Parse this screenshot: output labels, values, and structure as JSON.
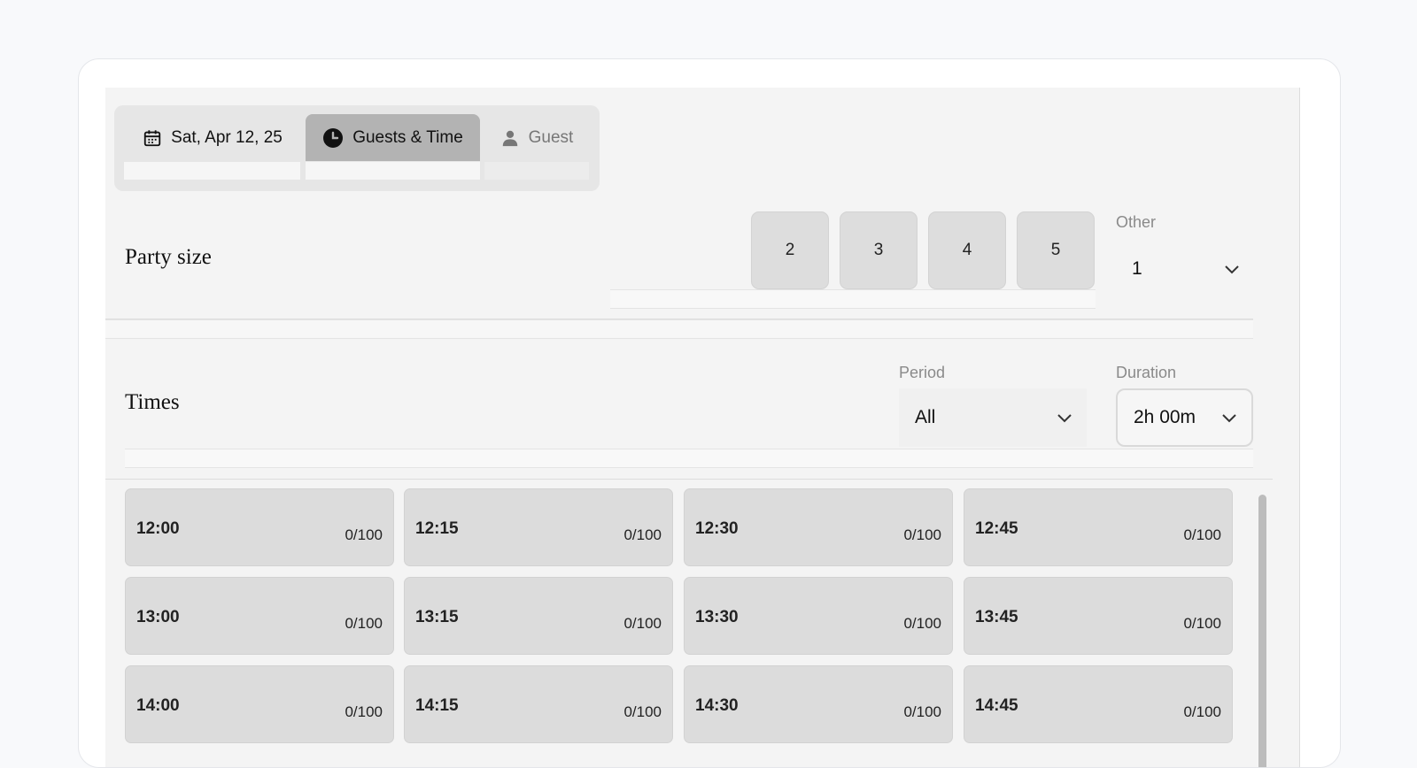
{
  "tabs": [
    {
      "label": "Sat, Apr 12, 25",
      "icon": "calendar-icon"
    },
    {
      "label": "Guests & Time",
      "icon": "clock-icon",
      "active": true
    },
    {
      "label": "Guest",
      "icon": "person-icon"
    }
  ],
  "party": {
    "title": "Party size",
    "sizes": [
      "2",
      "3",
      "4",
      "5"
    ],
    "other_label": "Other",
    "other_value": "1"
  },
  "times": {
    "title": "Times",
    "period_label": "Period",
    "period_value": "All",
    "duration_label": "Duration",
    "duration_value": "2h 00m",
    "slots": [
      {
        "time": "12:00",
        "capacity": "0/100"
      },
      {
        "time": "12:15",
        "capacity": "0/100"
      },
      {
        "time": "12:30",
        "capacity": "0/100"
      },
      {
        "time": "12:45",
        "capacity": "0/100"
      },
      {
        "time": "13:00",
        "capacity": "0/100"
      },
      {
        "time": "13:15",
        "capacity": "0/100"
      },
      {
        "time": "13:30",
        "capacity": "0/100"
      },
      {
        "time": "13:45",
        "capacity": "0/100"
      },
      {
        "time": "14:00",
        "capacity": "0/100"
      },
      {
        "time": "14:15",
        "capacity": "0/100"
      },
      {
        "time": "14:30",
        "capacity": "0/100"
      },
      {
        "time": "14:45",
        "capacity": "0/100"
      }
    ]
  },
  "colors": {
    "active_tab": "#b3b3b3",
    "slot_bg": "#dcdcdc",
    "panel_bg": "#f4f4f4"
  }
}
